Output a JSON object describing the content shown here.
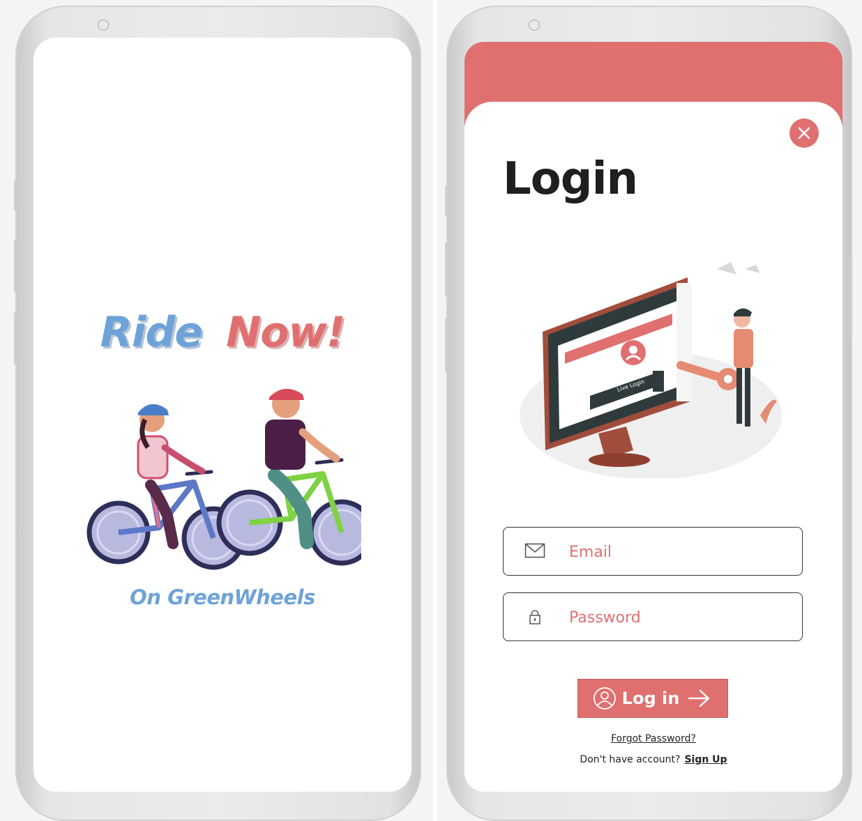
{
  "splash": {
    "brand_word1": "Ride",
    "brand_word2": "Now!",
    "tagline": "On GreenWheels"
  },
  "login": {
    "title": "Login",
    "email_placeholder": "Email",
    "password_placeholder": "Password",
    "login_button": "Log in",
    "forgot_password": "Forgot Password?",
    "no_account_text": "Don't have account?",
    "signup_link": "Sign Up",
    "illustration_button_text": "Live Login"
  },
  "colors": {
    "accent": "#e07070",
    "brand_blue": "#6fa3d8"
  },
  "icons": [
    "close-icon",
    "mail-icon",
    "lock-icon",
    "user-circle-icon",
    "arrow-right-icon"
  ]
}
